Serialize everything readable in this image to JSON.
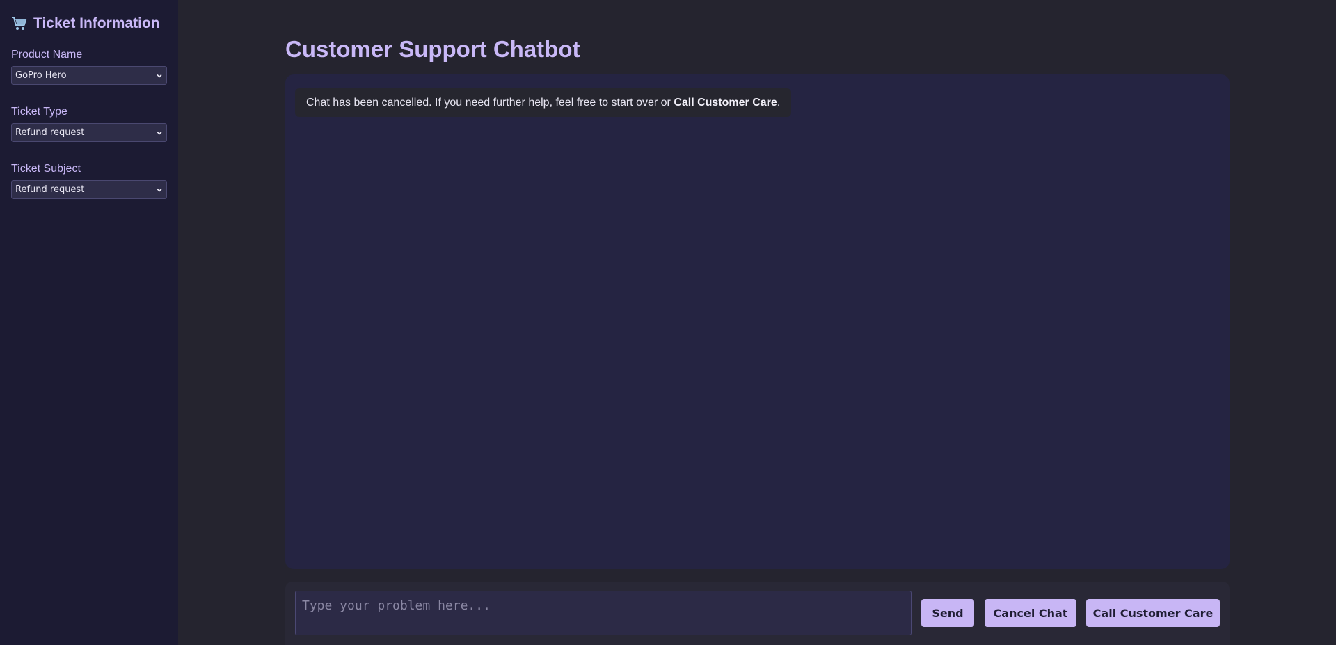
{
  "sidebar": {
    "icon": "shopping-cart-icon",
    "title": "Ticket Information",
    "fields": [
      {
        "label": "Product Name",
        "value": "GoPro Hero"
      },
      {
        "label": "Ticket Type",
        "value": "Refund request"
      },
      {
        "label": "Ticket Subject",
        "value": "Refund request"
      }
    ]
  },
  "main": {
    "title": "Customer Support Chatbot",
    "messages": [
      {
        "text_before": "Chat has been cancelled. If you need further help, feel free to start over or ",
        "text_bold": "Call Customer Care",
        "text_after": "."
      }
    ]
  },
  "input": {
    "placeholder": "Type your problem here...",
    "value": ""
  },
  "buttons": {
    "send": "Send",
    "cancel": "Cancel Chat",
    "call": "Call Customer Care"
  },
  "colors": {
    "accent": "#c8b6f5",
    "sidebar_bg": "#1c1b33",
    "panel_bg": "#252442",
    "page_bg": "#25242f"
  }
}
